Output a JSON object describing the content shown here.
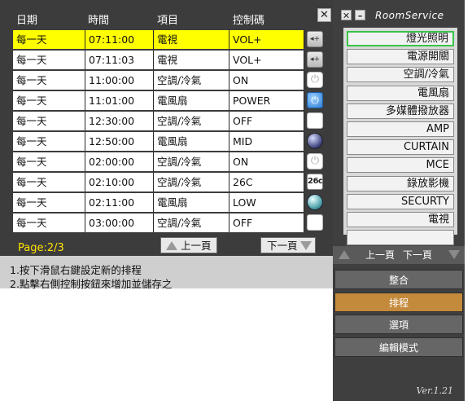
{
  "schedule": {
    "headers": [
      "日期",
      "時間",
      "項目",
      "控制碼"
    ],
    "rows": [
      {
        "date": "每一天",
        "time": "07:11:00",
        "item": "電視",
        "code": "VOL+",
        "icon": "vol-icon",
        "selected": true
      },
      {
        "date": "每一天",
        "time": "07:11:03",
        "item": "電視",
        "code": "VOL+",
        "icon": "vol-icon",
        "selected": false
      },
      {
        "date": "每一天",
        "time": "11:00:00",
        "item": "空調/冷氣",
        "code": "ON",
        "icon": "power-icon",
        "selected": false
      },
      {
        "date": "每一天",
        "time": "11:01:00",
        "item": "電風扇",
        "code": "POWER",
        "icon": "power-blue-icon",
        "selected": false
      },
      {
        "date": "每一天",
        "time": "12:30:00",
        "item": "空調/冷氣",
        "code": "OFF",
        "icon": "off-icon",
        "selected": false
      },
      {
        "date": "每一天",
        "time": "12:50:00",
        "item": "電風扇",
        "code": "MID",
        "icon": "mid-icon",
        "selected": false
      },
      {
        "date": "每一天",
        "time": "02:00:00",
        "item": "空調/冷氣",
        "code": "ON",
        "icon": "power-icon",
        "selected": false
      },
      {
        "date": "每一天",
        "time": "02:10:00",
        "item": "空調/冷氣",
        "code": "26C",
        "icon": "temp-icon",
        "selected": false
      },
      {
        "date": "每一天",
        "time": "02:11:00",
        "item": "電風扇",
        "code": "LOW",
        "icon": "low-icon",
        "selected": false
      },
      {
        "date": "每一天",
        "time": "03:00:00",
        "item": "空調/冷氣",
        "code": "OFF",
        "icon": "off-icon",
        "selected": false
      }
    ],
    "page_label": "Page:2/3",
    "prev_label": "上一頁",
    "next_label": "下一頁",
    "instructions": [
      "1.按下滑鼠右鍵設定新的排程",
      "2.點擊右側控制按鈕來增加並儲存之"
    ],
    "icon_text": {
      "vol": "+",
      "power": "⏻",
      "temp": "26c"
    }
  },
  "room_service": {
    "title": "RoomService",
    "devices": [
      "燈光照明",
      "電源開關",
      "空調/冷氣",
      "電風扇",
      "多媒體撥放器",
      "AMP",
      "CURTAIN",
      "MCE",
      "錄放影機",
      "SECURTY",
      "電視",
      ""
    ],
    "highlighted_device": 0,
    "prev_label": "上一頁",
    "next_label": "下一頁",
    "menu": [
      "整合",
      "排程",
      "選項",
      "編輯模式"
    ],
    "active_menu": 1,
    "version": "Ver.1.21"
  },
  "colors": {
    "selected_row": "#ffff00",
    "page_label": "#ffe200",
    "active_menu": "#c48a3c",
    "highlight_border": "#39c44b"
  }
}
